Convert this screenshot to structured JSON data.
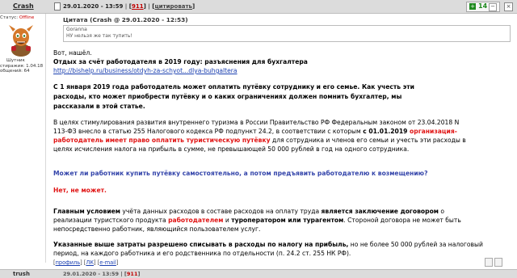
{
  "post": {
    "author": "Crash",
    "date": "29.01.2020 - 13:59",
    "separator": "|",
    "number": "911",
    "quote_action": "цитировать",
    "rating": "14",
    "rating_plus": "+",
    "rating_minus": "−",
    "close": "×"
  },
  "user": {
    "status_label": "Статус:",
    "status_value": "Offline",
    "title": "Шутник",
    "experience": "стиражия: 1.04.18",
    "messages": "общений: 64"
  },
  "quote": {
    "header": "Цитата (Crash @ 29.01.2020 - 12:53)",
    "line1": "Goranna",
    "line2": "НУ нельзя же так тупить!"
  },
  "content": {
    "intro": "Вот, нашёл.",
    "heading": "Отдых за счёт работодателя в 2019 году: разъяснения для бухгалтера",
    "link": "http://bishelp.ru/business/otdyh-za-schyot...dlya-buhgaltera",
    "lead": "С 1 января 2019 года работодатель может оплатить путёвку сотруднику и его семье. Как учесть эти расходы, кто может приобрести путёвку и о каких ограничениях должен помнить бухгалтер, мы рассказали в этой статье.",
    "p2_a": "В целях стимулирования развития внутреннего туризма в России Правительство РФ Федеральным законом от 23.04.2018 N 113-ФЗ внесло в статью 255 Налогового кодекса РФ подпункт 24.2, в соответствии с которым ",
    "p2_b": "с 01.01.2019 ",
    "p2_c": "организация-работодатель имеет право оплатить туристическую путёвку",
    "p2_d": " для сотрудника и членов его семьи и учесть эти расходы в целях исчисления налога на прибыль в сумме, не превышающей 50 000 рублей в год на одного сотрудника.",
    "question": "Может ли работник купить путёвку самостоятельно, а потом предъявить работодателю к возмещению?",
    "answer": "Нет, не может.",
    "p3_a": "Главным условием",
    "p3_b": " учёта данных расходов в составе расходов на оплату труда ",
    "p3_c": "является заключение договором",
    "p3_d": " о реализации туристского продукта ",
    "p3_e": "работодателем",
    "p3_f": " и ",
    "p3_g": "туроператором или турагентом",
    "p3_h": ". Стороной договора не может быть непосредственно работник, являющийся пользователем услуг.",
    "p4_a": "Указанные выше затраты разрешено списывать в расходы по налогу на прибыль,",
    "p4_b": " но не более 50 000 рублей за налоговый период, на каждого работника и его родственника по отдельности (п. 24.2 ст. 255 НК РФ)."
  },
  "footer": {
    "open": "[",
    "profile": "профиль",
    "sep1": "] [",
    "pm": "ЛК",
    "sep2": "] [",
    "email": "e-mail",
    "close": "]"
  },
  "next": {
    "author": "trush",
    "date": "29.01.2020 - 13:59 |",
    "number": "911"
  }
}
